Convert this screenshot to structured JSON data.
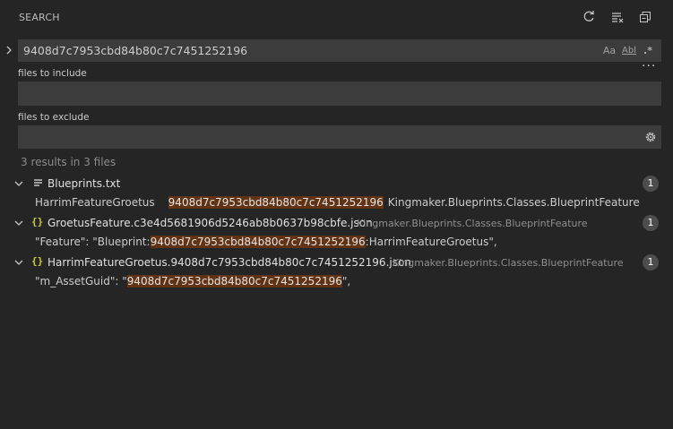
{
  "header": {
    "title": "SEARCH",
    "actions": [
      "refresh-icon",
      "clear-results-icon",
      "collapse-all-icon"
    ]
  },
  "search": {
    "query": "9408d7c7953cbd84b80c7c7451252196",
    "options": {
      "match_case": "Aa",
      "whole_word": "Abl",
      "regex": ".*"
    }
  },
  "include": {
    "label": "files to include",
    "value": ""
  },
  "exclude": {
    "label": "files to exclude",
    "value": ""
  },
  "summary": "3 results in 3 files",
  "results": [
    {
      "file": "Blueprints.txt",
      "path": "",
      "count": "1",
      "icon": "text-file-icon",
      "match": {
        "before": "HarrimFeatureGroetus",
        "highlight": "9408d7c7953cbd84b80c7c7451252196",
        "after": "Kingmaker.Blueprints.Classes.BlueprintFeature"
      }
    },
    {
      "file": "GroetusFeature.c3e4d5681906d5246ab8b0637b98cbfe.json",
      "path": "Kingmaker.Blueprints.Classes.BlueprintFeature",
      "count": "1",
      "icon": "json-file-icon",
      "match": {
        "before": "\"Feature\": \"Blueprint:",
        "highlight": "9408d7c7953cbd84b80c7c7451252196",
        "after": ":HarrimFeatureGroetus\","
      }
    },
    {
      "file": "HarrimFeatureGroetus.9408d7c7953cbd84b80c7c7451252196.json",
      "path": "Kingmaker.Blueprints.Classes.BlueprintFeature",
      "count": "1",
      "icon": "json-file-icon",
      "match": {
        "before": "\"m_AssetGuid\": \"",
        "highlight": "9408d7c7953cbd84b80c7c7451252196",
        "after": "\","
      }
    }
  ],
  "colors": {
    "background": "#252526",
    "input": "#3c3c3c",
    "highlight": "#613214",
    "json_icon": "#cbcb41"
  }
}
